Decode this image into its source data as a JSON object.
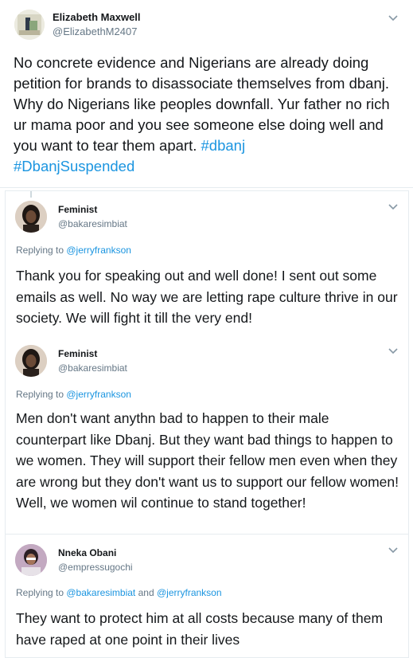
{
  "tweets": [
    {
      "name": "Elizabeth Maxwell",
      "handle": "@ElizabethM2407",
      "text": "No concrete evidence and Nigerians are already doing petition for brands to disassociate themselves from dbanj. Why do Nigerians like peoples downfall. Yur father no rich ur mama poor and you see someone else doing well and you want to tear them apart. ",
      "hashtag1": "#dbanj",
      "hashtag2": "#DbanjSuspended"
    },
    {
      "name": "Feminist",
      "handle": "@bakaresimbiat",
      "replying_prefix": "Replying to ",
      "replying_to": "@jerryfrankson",
      "text": "Thank you for speaking out and well done! I sent out some emails as well. No way we are letting rape culture thrive in our society. We will fight it till the very end!"
    },
    {
      "name": "Feminist",
      "handle": "@bakaresimbiat",
      "replying_prefix": "Replying to ",
      "replying_to": "@jerryfrankson",
      "text": "Men don't want anythn bad to happen to their male counterpart like Dbanj. But they want bad things to happen to we women. They will support their fellow men even when they are wrong but they don't want us to support our fellow women! Well, we women wil continue to stand together!"
    },
    {
      "name": "Nneka Obani",
      "handle": "@empressugochi",
      "replying_prefix": "Replying to ",
      "replying_to_1": "@bakaresimbiat",
      "replying_and": " and ",
      "replying_to_2": "@jerryfrankson",
      "text": "They want to protect him at all costs because many of them have raped at one point in their lives"
    }
  ],
  "colors": {
    "link": "#1b95e0",
    "secondary_text": "#657786",
    "border": "#e6ecf0"
  }
}
